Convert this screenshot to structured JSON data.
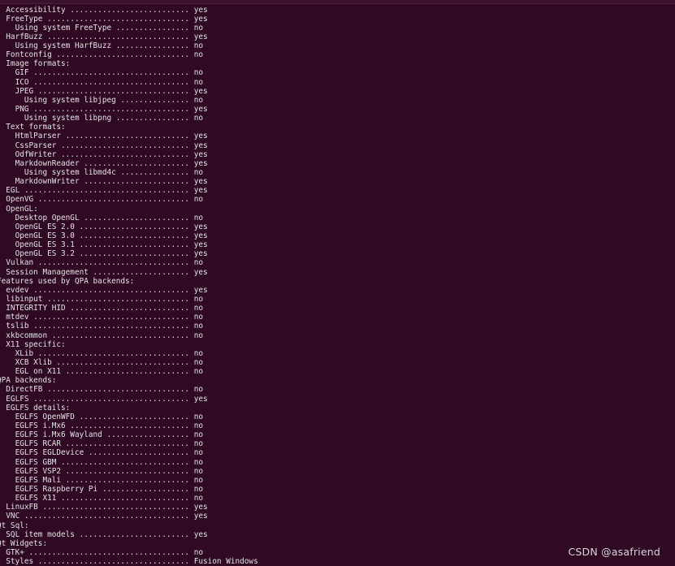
{
  "terminal": {
    "lines": [
      "  Accessibility .......................... yes",
      "  FreeType ............................... yes",
      "    Using system FreeType ................ no",
      "  HarfBuzz ............................... yes",
      "    Using system HarfBuzz ................ no",
      "  Fontconfig ............................. no",
      "  Image formats:",
      "    GIF .................................. no",
      "    ICO .................................. no",
      "    JPEG ................................. yes",
      "      Using system libjpeg ............... no",
      "    PNG .................................. yes",
      "      Using system libpng ................ no",
      "  Text formats:",
      "    HtmlParser ........................... yes",
      "    CssParser ............................ yes",
      "    OdfWriter ............................ yes",
      "    MarkdownReader ....................... yes",
      "      Using system libmd4c ............... no",
      "    MarkdownWriter ....................... yes",
      "  EGL .................................... yes",
      "  OpenVG ................................. no",
      "  OpenGL:",
      "    Desktop OpenGL ....................... no",
      "    OpenGL ES 2.0 ........................ yes",
      "    OpenGL ES 3.0 ........................ yes",
      "    OpenGL ES 3.1 ........................ yes",
      "    OpenGL ES 3.2 ........................ yes",
      "  Vulkan ................................. no",
      "  Session Management ..................... yes",
      "Features used by QPA backends:",
      "  evdev .................................. yes",
      "  libinput ............................... no",
      "  INTEGRITY HID .......................... no",
      "  mtdev .................................. no",
      "  tslib .................................. no",
      "  xkbcommon .............................. no",
      "  X11 specific:",
      "    XLib ................................. no",
      "    XCB Xlib ............................. no",
      "    EGL on X11 ........................... no",
      "QPA backends:",
      "  DirectFB ............................... no",
      "  EGLFS .................................. yes",
      "  EGLFS details:",
      "    EGLFS OpenWFD ........................ no",
      "    EGLFS i.Mx6 .......................... no",
      "    EGLFS i.Mx6 Wayland .................. no",
      "    EGLFS RCAR ........................... no",
      "    EGLFS EGLDevice ...................... no",
      "    EGLFS GBM ............................ no",
      "    EGLFS VSP2 ........................... no",
      "    EGLFS Mali ........................... no",
      "    EGLFS Raspberry Pi ................... no",
      "    EGLFS X11 ............................ no",
      "  LinuxFB ................................ yes",
      "  VNC .................................... yes",
      "Qt Sql:",
      "  SQL item models ........................ yes",
      "Qt Widgets:",
      "  GTK+ ................................... no",
      "  Styles ................................. Fusion Windows"
    ]
  },
  "watermark": {
    "text": "CSDN @asafriend"
  },
  "colors": {
    "background": "#300a24",
    "text": "#e3e3e3"
  }
}
